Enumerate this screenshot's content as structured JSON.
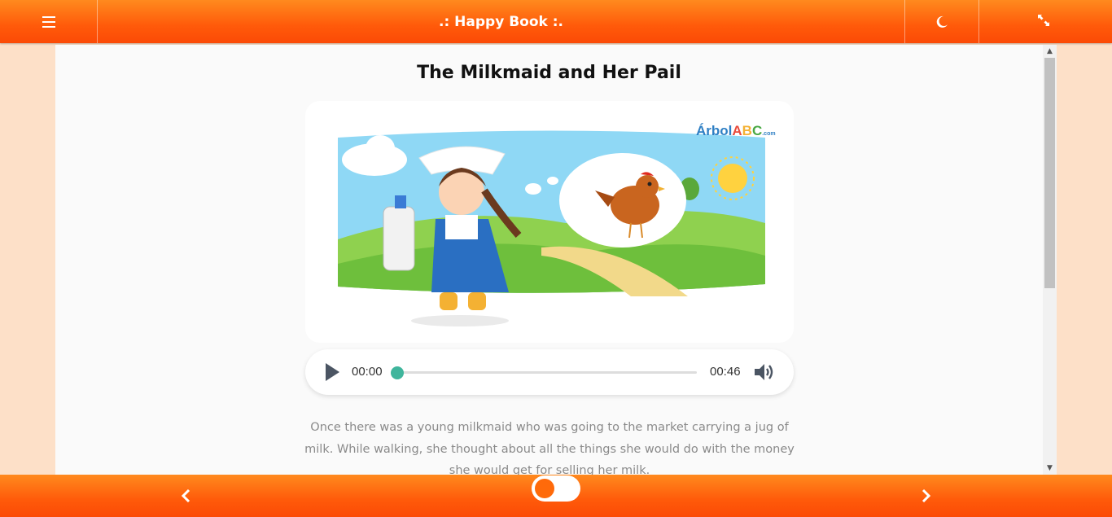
{
  "header": {
    "title": ".: Happy Book :.",
    "menu_icon": "menu-icon",
    "theme_icon": "moon-icon",
    "fullscreen_icon": "fullscreen-icon"
  },
  "story": {
    "title": "The Milkmaid and Her Pail",
    "illustration_logo": "ÁrbolABC",
    "illustration_logo_suffix": ".com",
    "text": "Once there was a young milkmaid who was going to the market carrying a jug of milk. While walking, she thought about all the things she would do with the money she would get for selling her milk."
  },
  "audio": {
    "current_time": "00:00",
    "duration": "00:46",
    "progress": 0
  },
  "footer": {
    "prev_icon": "chevron-left-icon",
    "next_icon": "chevron-right-icon",
    "toggle_state": "off"
  },
  "colors": {
    "bar_orange": "#ff5a0a",
    "accent_green": "#3fb59c",
    "page_bg": "#fde0c8"
  }
}
